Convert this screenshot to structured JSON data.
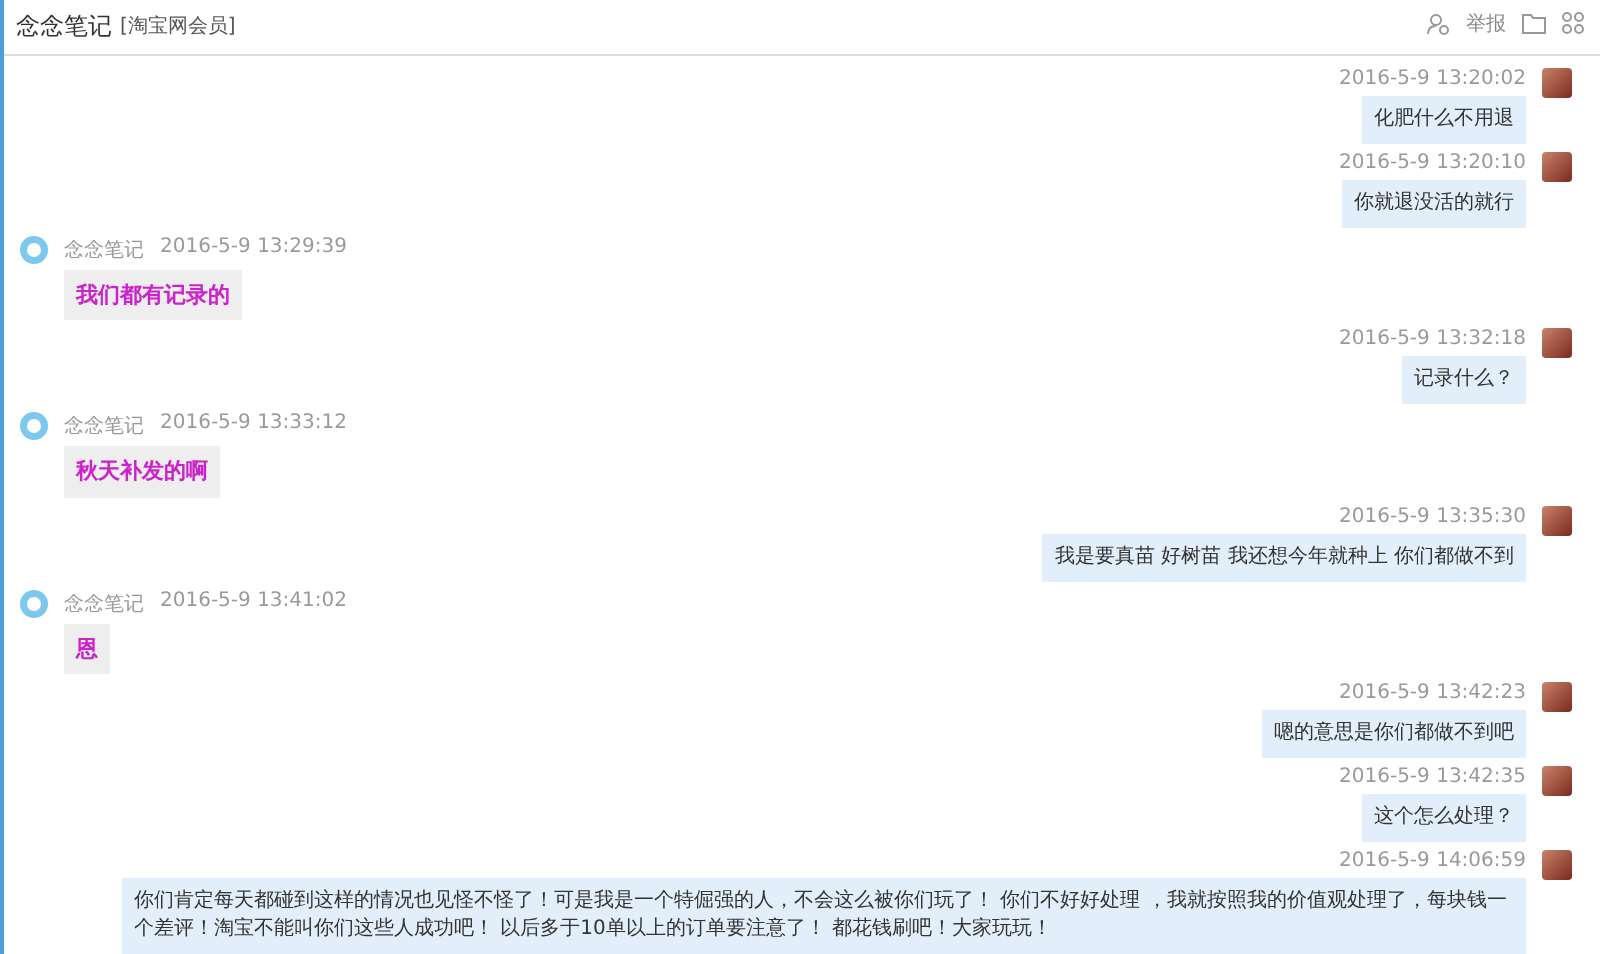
{
  "header": {
    "title": "念念笔记",
    "tag": "[淘宝网会员]",
    "report": "举报"
  },
  "messages": [
    {
      "kind": "sent",
      "time": "2016-5-9 13:20:02",
      "text": "化肥什么不用退"
    },
    {
      "kind": "sent",
      "time": "2016-5-9 13:20:10",
      "text": "你就退没活的就行"
    },
    {
      "kind": "received",
      "name": "念念笔记",
      "time": "2016-5-9 13:29:39",
      "text": "我们都有记录的"
    },
    {
      "kind": "sent",
      "time": "2016-5-9 13:32:18",
      "text": "记录什么？"
    },
    {
      "kind": "received",
      "name": "念念笔记",
      "time": "2016-5-9 13:33:12",
      "text": "秋天补发的啊"
    },
    {
      "kind": "sent",
      "time": "2016-5-9 13:35:30",
      "text": "我是要真苗 好树苗  我还想今年就种上 你们都做不到"
    },
    {
      "kind": "received",
      "name": "念念笔记",
      "time": "2016-5-9 13:41:02",
      "text": "恩"
    },
    {
      "kind": "sent",
      "time": "2016-5-9 13:42:23",
      "text": "嗯的意思是你们都做不到吧"
    },
    {
      "kind": "sent",
      "time": "2016-5-9 13:42:35",
      "text": "这个怎么处理？"
    },
    {
      "kind": "sent",
      "time": "2016-5-9 14:06:59",
      "text": "你们肯定每天都碰到这样的情况也见怪不怪了！可是我是一个特倔强的人，不会这么被你们玩了！ 你们不好好处理 ，我就按照我的价值观处理了，每块钱一个差评！淘宝不能叫你们这些人成功吧！ 以后多于10单以上的订单要注意了！ 都花钱刷吧！大家玩玩！"
    }
  ]
}
